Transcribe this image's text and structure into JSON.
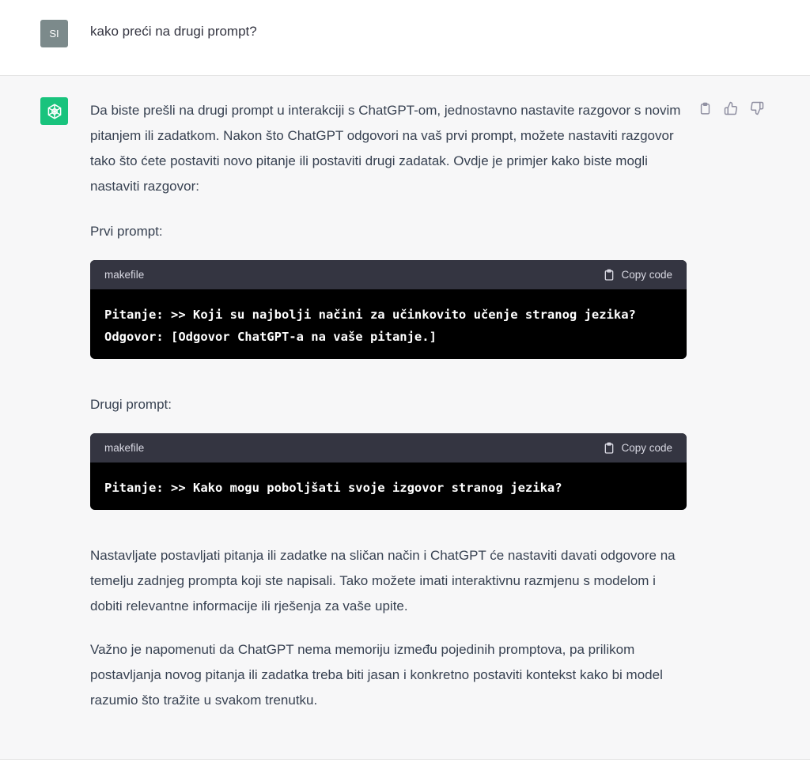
{
  "user_message": {
    "avatar_initials": "SI",
    "text": "kako preći na drugi prompt?"
  },
  "assistant_message": {
    "avatar_icon": "openai-logo-icon",
    "paragraphs": [
      "Da biste prešli na drugi prompt u interakciji s ChatGPT-om, jednostavno nastavite razgovor s novim pitanjem ili zadatkom. Nakon što ChatGPT odgovori na vaš prvi prompt, možete nastaviti razgovor tako što ćete postaviti novo pitanje ili postaviti drugi zadatak. Ovdje je primjer kako biste mogli nastaviti razgovor:",
      "Prvi prompt:",
      "Drugi prompt:",
      "Nastavljate postavljati pitanja ili zadatke na sličan način i ChatGPT će nastaviti davati odgovore na temelju zadnjeg prompta koji ste napisali. Tako možete imati interaktivnu razmjenu s modelom i dobiti relevantne informacije ili rješenja za vaše upite.",
      "Važno je napomenuti da ChatGPT nema memoriju između pojedinih promptova, pa prilikom postavljanja novog pitanja ili zadatka treba biti jasan i konkretno postaviti kontekst kako bi model razumio što tražite u svakom trenutku."
    ],
    "code_blocks": [
      {
        "language": "makefile",
        "copy_label": "Copy code",
        "lines": [
          "Pitanje: >> Koji su najbolji načini za učinkovito učenje stranog jezika?",
          "Odgovor: [Odgovor ChatGPT-a na vaše pitanje.]"
        ]
      },
      {
        "language": "makefile",
        "copy_label": "Copy code",
        "lines": [
          "Pitanje: >> Kako mogu poboljšati svoje izgovor stranog jezika?"
        ]
      }
    ],
    "actions": [
      "clipboard-icon",
      "thumbs-up-icon",
      "thumbs-down-icon"
    ]
  },
  "colors": {
    "user_avatar_bg": "#7c8a8b",
    "gpt_avatar_bg": "#19c37d",
    "assistant_bg": "#f7f7f8",
    "code_header_bg": "#343541",
    "code_body_bg": "#000000"
  }
}
